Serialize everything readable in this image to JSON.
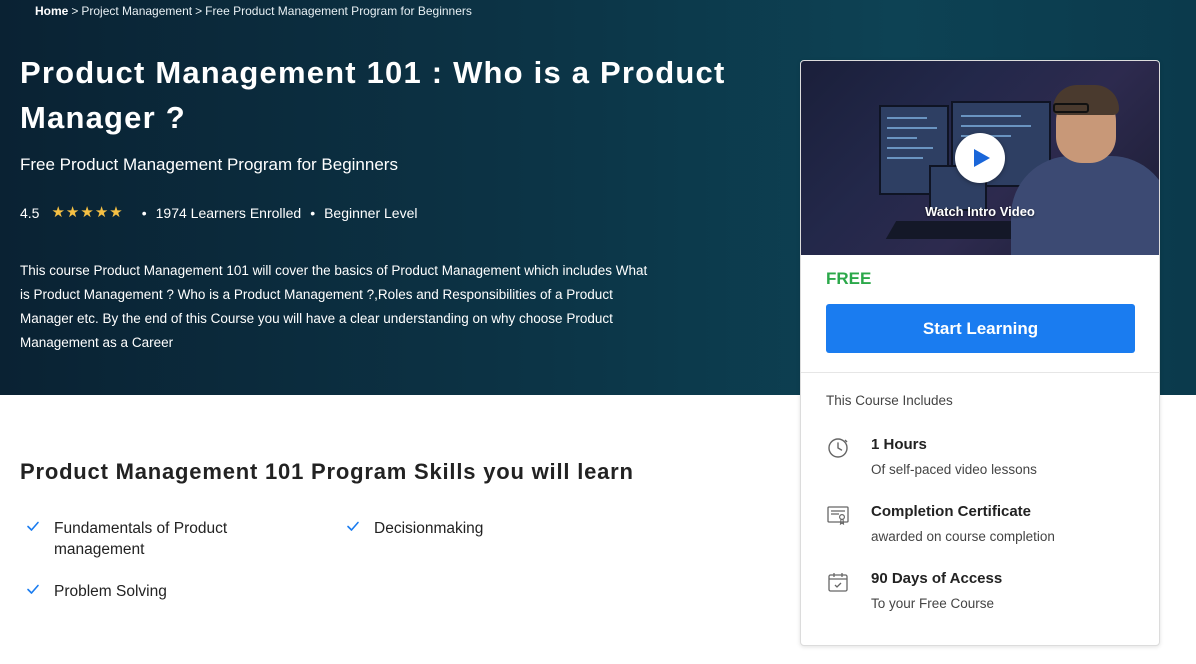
{
  "breadcrumb": {
    "home": "Home",
    "sep1": ">",
    "category": "Project Management",
    "sep2": ">",
    "current": "Free Product Management Program for Beginners"
  },
  "hero": {
    "title": "Product Management 101 : Who is a Product Manager ?",
    "subtitle": "Free Product Management Program for Beginners",
    "rating": "4.5",
    "stars_filled": 5,
    "learners": "1974 Learners Enrolled",
    "level": "Beginner Level",
    "dot": "•",
    "description": "This course Product Management 101 will cover the basics of Product Management which includes What is Product Management ? Who is a Product Management ?,Roles and Responsibilities of a Product Manager etc. By the end of this Course you will have a clear understanding on why choose Product Management as a Career"
  },
  "card": {
    "video_label": "Watch Intro Video",
    "price": "FREE",
    "cta": "Start Learning",
    "includes_title": "This Course Includes",
    "includes": [
      {
        "icon": "clock-icon",
        "title": "1 Hours",
        "sub": "Of self-paced video lessons"
      },
      {
        "icon": "certificate-icon",
        "title": "Completion Certificate",
        "sub": "awarded on course completion"
      },
      {
        "icon": "calendar-icon",
        "title": "90 Days of Access",
        "sub": "To your Free Course"
      }
    ]
  },
  "skills": {
    "title": "Product Management 101 Program Skills you will learn",
    "items": [
      "Fundamentals of Product management",
      "Decisionmaking",
      "Problem Solving"
    ]
  },
  "colors": {
    "hero_bg": "#0c3446",
    "price_green": "#2ba84a",
    "cta_blue": "#1a7cf0",
    "star": "#f5c044",
    "check": "#1a7cf0"
  }
}
